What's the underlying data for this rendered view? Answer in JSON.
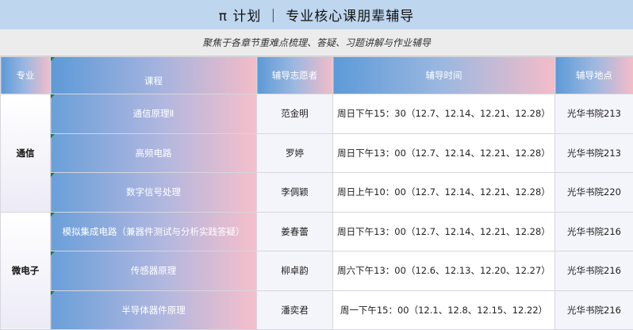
{
  "header": {
    "title": "π 计划 ｜ 专业核心课朋辈辅导",
    "subtitle": "聚焦于各章节重难点梳理、答疑、习题讲解与作业辅导"
  },
  "table": {
    "columns": {
      "major": "专业",
      "course": "课程",
      "volunteer": "辅导志愿者",
      "time": "辅导时间",
      "location": "辅导地点"
    },
    "groups": [
      {
        "major": "通信",
        "rows": [
          {
            "course": "通信原理Ⅱ",
            "volunteer": "范金明",
            "time": "周日下午15：30（12.7、12.14、12.21、12.28）",
            "location": "光华书院213"
          },
          {
            "course": "高频电路",
            "volunteer": "罗婷",
            "time": "周日下午13：00（12.7、12.14、12.21、12.28）",
            "location": "光华书院213"
          },
          {
            "course": "数字信号处理",
            "volunteer": "李倜颖",
            "time": "周日上午10：00（12.7、12.14、12.21、12.28）",
            "location": "光华书院220"
          }
        ]
      },
      {
        "major": "微电子",
        "rows": [
          {
            "course": "模拟集成电路（兼器件测试与分析实践答疑）",
            "volunteer": "姜春蕾",
            "time": "周日下午13：00（12.7、12.14、12.21、12.28）",
            "location": "光华书院216"
          },
          {
            "course": "传感器原理",
            "volunteer": "柳卓韵",
            "time": "周六下午13：00（12.6、12.13、12.20、12.27）",
            "location": "光华书院216"
          },
          {
            "course": "半导体器件原理",
            "volunteer": "潘奕君",
            "time": "周一下午15：00（12.1、12.8、12.15、12.22）",
            "location": "光华书院216"
          }
        ]
      }
    ]
  }
}
